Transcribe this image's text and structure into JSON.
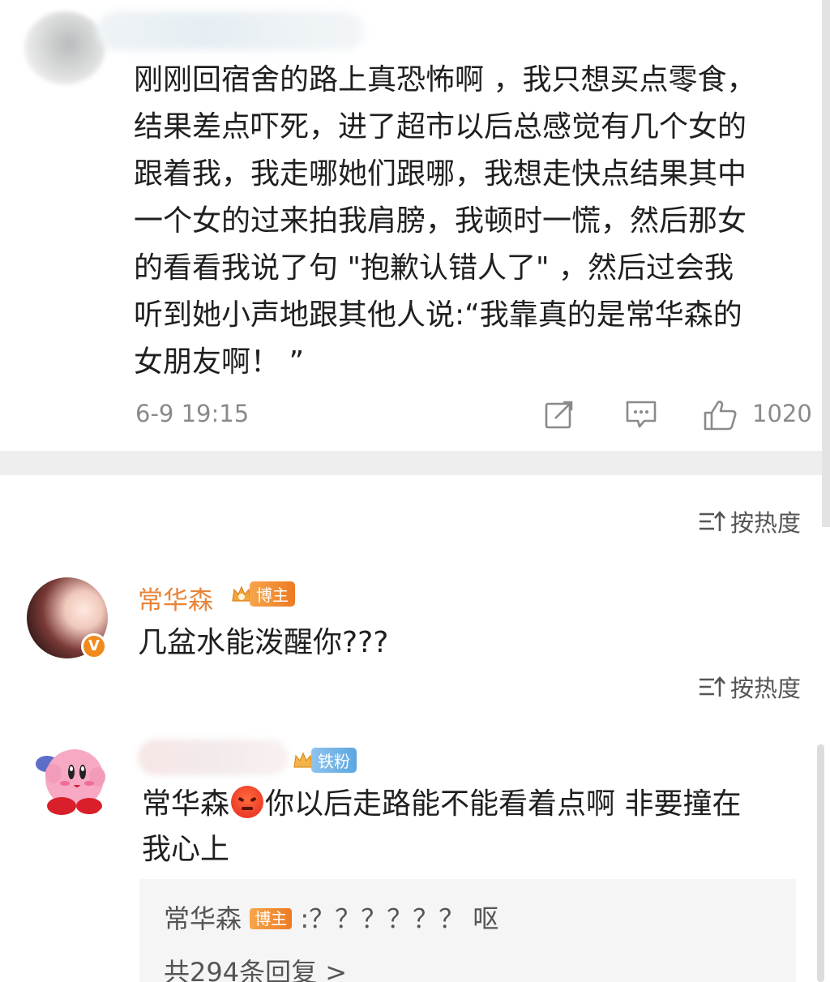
{
  "post": {
    "text_lines": [
      "刚刚回宿舍的路上真恐怖啊 ，我只想买点零食，",
      "结果差点吓死，进了超市以后总感觉有几个女的",
      "跟着我，我走哪她们跟哪，我想走快点结果其中",
      "一个女的过来拍我肩膀，我顿时一慌，然后那女",
      "的看看我说了句 \"抱歉认错人了\" ，然后过会我",
      "听到她小声地跟其他人说:“我靠真的是常华森的",
      "女朋友啊！ ”"
    ],
    "time": "6-9 19:15",
    "like_count": "1020"
  },
  "sort_label": "按热度",
  "comments": [
    {
      "name": "常华森",
      "tag": "博主",
      "badge": "V",
      "text": "几盆水能泼醒你???"
    },
    {
      "tag": "铁粉",
      "text_before": "常华森",
      "text_after": "你以后走路能不能看着点啊 非要撞在",
      "text_line2": "我心上",
      "reply": {
        "name": "常华森",
        "tag": "博主",
        "text": ":？？？？？？ 呕",
        "more": "共294条回复 >"
      }
    }
  ],
  "colors": {
    "brand_orange": "#e8843a",
    "fan_blue": "#5ba7e2",
    "meta_gray": "#8a8a8a"
  },
  "icons": [
    "share-icon",
    "comment-icon",
    "like-icon",
    "sort-icon",
    "crown-icon",
    "angry-face-icon"
  ]
}
